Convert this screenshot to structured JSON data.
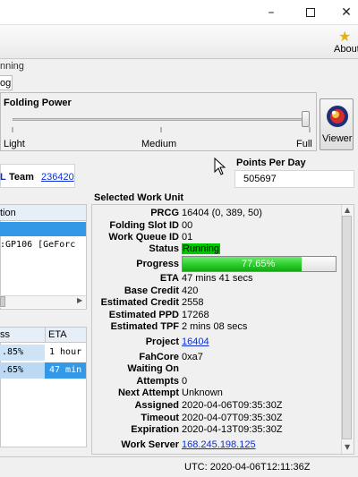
{
  "window": {
    "minimize_icon": "minimize-icon",
    "maximize_icon": "maximize-icon",
    "close_icon": "close-icon"
  },
  "toolbar": {
    "about_label": "About",
    "about_icon": "star-icon"
  },
  "status_fragment": "nning",
  "tab_fragment": "og",
  "folding_power": {
    "title": "Folding Power",
    "light": "Light",
    "medium": "Medium",
    "full": "Full",
    "level_fraction": 1.0
  },
  "viewer": {
    "label": "Viewer",
    "icon": "globe-icon"
  },
  "team": {
    "label": "Team",
    "value": "236420",
    "prefix_fragment": "L"
  },
  "ppd": {
    "label": "Points Per Day",
    "value": "505697"
  },
  "slots": {
    "header_fragment": "tion",
    "row_fragment": ":GP106 [GeForc"
  },
  "queue": {
    "col_progress": "ss",
    "col_eta": "ETA",
    "rows": [
      {
        "progress": ".85%",
        "eta": "1 hour"
      },
      {
        "progress": ".65%",
        "eta": "47 min"
      }
    ]
  },
  "work_unit": {
    "title": "Selected Work Unit",
    "fields": [
      {
        "label": "PRCG",
        "value": "16404 (0, 389, 50)"
      },
      {
        "label": "Folding Slot ID",
        "value": "00"
      },
      {
        "label": "Work Queue ID",
        "value": "01"
      },
      {
        "label": "Status",
        "value": "Running"
      },
      {
        "label": "Progress",
        "value": "77.65%"
      },
      {
        "label": "ETA",
        "value": "47 mins 41 secs"
      },
      {
        "label": "Base Credit",
        "value": "420"
      },
      {
        "label": "Estimated Credit",
        "value": "2558"
      },
      {
        "label": "Estimated PPD",
        "value": "17268"
      },
      {
        "label": "Estimated TPF",
        "value": "2 mins 08 secs"
      },
      {
        "label": "Project",
        "value": "16404"
      },
      {
        "label": "FahCore",
        "value": "0xa7"
      },
      {
        "label": "Waiting On",
        "value": ""
      },
      {
        "label": "Attempts",
        "value": "0"
      },
      {
        "label": "Next Attempt",
        "value": "Unknown"
      },
      {
        "label": "Assigned",
        "value": "2020-04-06T09:35:30Z"
      },
      {
        "label": "Timeout",
        "value": "2020-04-07T09:35:30Z"
      },
      {
        "label": "Expiration",
        "value": "2020-04-13T09:35:30Z"
      },
      {
        "label": "Work Server",
        "value": "168.245.198.125"
      }
    ],
    "progress_fraction": 0.7765,
    "colors": {
      "status_bg": "#00c800",
      "progress_fill": "#2ed12e",
      "link": "#0b2fd6"
    }
  },
  "statusbar": {
    "utc": "UTC: 2020-04-06T12:11:36Z"
  }
}
